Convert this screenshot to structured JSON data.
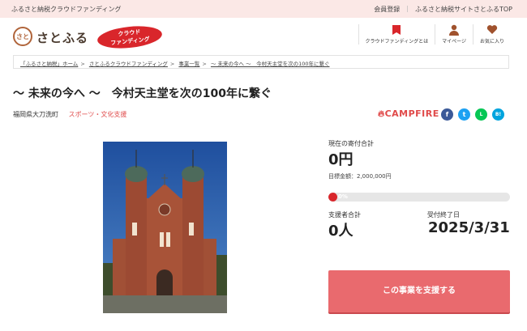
{
  "topbar": {
    "left": "ふるさと納税クラウドファンディング",
    "links": [
      "会員登録",
      "ふるさと納税サイトさとふるTOP"
    ]
  },
  "header": {
    "logo_mark": "さと",
    "logo_text": "さとふる",
    "cf_badge_line1": "クラウド",
    "cf_badge_line2": "ファンディング",
    "nav": [
      {
        "icon": "bookmark-icon",
        "label": "クラウドファンディングとは"
      },
      {
        "icon": "user-icon",
        "label": "マイページ"
      },
      {
        "icon": "heart-icon",
        "label": "お気に入り"
      }
    ]
  },
  "breadcrumb": [
    "「ふるさと納税」ホーム",
    "さとふるクラウドファンディング",
    "事業一覧",
    "～ 未来の今へ ～　今村天主堂を次の100年に繋ぐ"
  ],
  "project": {
    "title": "～ 未来の今へ ～　今村天主堂を次の100年に繋ぐ",
    "location": "福岡県大刀洗町",
    "category": "スポーツ・文化支援"
  },
  "brand": {
    "campfire": "CAMPFIRE"
  },
  "share": [
    {
      "icon": "facebook-icon",
      "glyph": "f",
      "color": "#3b5998"
    },
    {
      "icon": "twitter-icon",
      "glyph": "t",
      "color": "#1da1f2"
    },
    {
      "icon": "line-icon",
      "glyph": "L",
      "color": "#06c755"
    },
    {
      "icon": "hatena-icon",
      "glyph": "B!",
      "color": "#00a4de"
    }
  ],
  "funding": {
    "current_label": "現在の寄付合計",
    "current_value": "0円",
    "target_text": "目標金額：2,000,000円",
    "progress_text": "0%",
    "progress_percent": 0,
    "supporters_label": "支援者合計",
    "supporters_value": "0人",
    "deadline_label": "受付終了日",
    "deadline_value": "2025/3/31"
  },
  "cta": {
    "label": "この事業を支援する"
  },
  "colors": {
    "accent": "#d9262b",
    "cta": "#e96a6e",
    "topbar": "#fbe8e6"
  }
}
